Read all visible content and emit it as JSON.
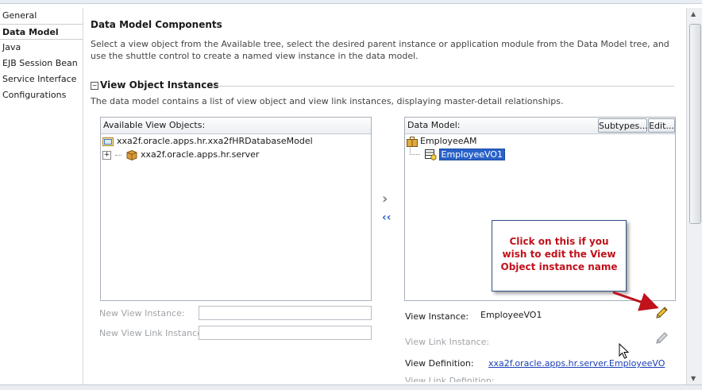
{
  "nav": {
    "items": [
      {
        "label": "General",
        "active": false
      },
      {
        "label": "Data Model",
        "active": true
      },
      {
        "label": "Java",
        "active": false
      },
      {
        "label": "EJB Session Bean",
        "active": false
      },
      {
        "label": "Service Interface",
        "active": false
      },
      {
        "label": "Configurations",
        "active": false
      }
    ]
  },
  "main": {
    "title": "Data Model Components",
    "description": "Select a view object from the Available tree, select the desired parent instance or application module from the Data Model tree, and use the shuttle control to create a named view instance in the data model.",
    "section_title": "View Object Instances",
    "section_description": "The data model contains a list of view object and view link instances, displaying master-detail relationships.",
    "collapse_glyph": "−"
  },
  "available": {
    "title": "Available View Objects:",
    "tree": [
      {
        "label": "xxa2f.oracle.apps.hr.xxa2fHRDatabaseModel",
        "icon": "folder-icon"
      },
      {
        "label": "xxa2f.oracle.apps.hr.server",
        "icon": "package-icon",
        "expander": "+"
      }
    ]
  },
  "datamodel": {
    "title": "Data Model:",
    "subtypes_label": "Subtypes...",
    "edit_label": "Edit...",
    "tree": [
      {
        "label": "EmployeeAM",
        "icon": "application-module-icon"
      },
      {
        "label": "EmployeeVO1",
        "icon": "view-object-icon",
        "selected": true
      }
    ]
  },
  "shuttle": {
    "add_glyph": "›",
    "remove_glyph": "‹‹"
  },
  "form_left": {
    "new_view_instance_label": "New View Instance:",
    "new_view_instance_value": "",
    "new_view_link_instance_label": "New View Link Instance:",
    "new_view_link_instance_value": ""
  },
  "form_right": {
    "view_instance_label": "View Instance:",
    "view_instance_value": "EmployeeVO1",
    "view_link_instance_label": "View Link Instance:",
    "view_definition_label": "View Definition:",
    "view_definition_value": "xxa2f.oracle.apps.hr.server.EmployeeVO",
    "view_link_definition_label": "View Link Definition:"
  },
  "callout": {
    "text": "Click on this if you wish to edit the View Object instance name"
  },
  "colors": {
    "callout_text": "#c0121b",
    "arrow": "#c0121b",
    "selection": "#2a62c9",
    "link": "#1a3fb5"
  }
}
